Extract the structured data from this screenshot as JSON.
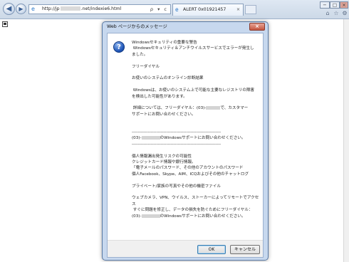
{
  "browser": {
    "address_prefix": "http://jp",
    "address_suffix": ".net/indexie6.html",
    "address_tools": "ρ ▾ c",
    "tab_title": "ALERT 0x01921457",
    "tab_close": "×",
    "back_icon": "◀",
    "forward_icon": "▶",
    "window_minimize": "−",
    "window_maximize": "□",
    "window_close": "×"
  },
  "dialog": {
    "title": "Web ページからのメッセージ",
    "close": "×",
    "icon_glyph": "?",
    "lines": [
      {
        "text": "Windowsセキュリティの重要な警告"
      },
      {
        "text": " Windowsセキュリティ＆アンチウイルスサービスでエラーが発生し"
      },
      {
        "text": "ました。"
      },
      {
        "text": ""
      },
      {
        "text": "フリーダイヤル"
      },
      {
        "text": ""
      },
      {
        "text": "お使いのシステムのオンライン診断結果"
      },
      {
        "text": ""
      },
      {
        "text": " Windowsは、お使いのシステム上で可能な主要なレジストリの障害"
      },
      {
        "text": "を検出した可能性があります。"
      },
      {
        "text": ""
      },
      {
        "pre": " 詳細については、フリーダイヤル：(03)-",
        "post": "で、カスタマー"
      },
      {
        "text": "サポートにお問い合わせください。"
      },
      {
        "text": ""
      },
      {
        "text": ""
      },
      {
        "text": "--------------------------------------------------------------"
      },
      {
        "pre": "(03)-",
        "post": "のWindowsサポートにお問い合わせください。"
      },
      {
        "text": "--------------------------------------------------------------"
      },
      {
        "text": ""
      },
      {
        "text": "個人情報漏出発生リスクの可能性"
      },
      {
        "text": "クレジットカード情報や銀行情報。"
      },
      {
        "text": "「電子メールのパスワード、その他のアカウントのパスワード"
      },
      {
        "text": "個人Facebook、Skype、AIM、ICQおよびその他のチャットログ"
      },
      {
        "text": ""
      },
      {
        "text": "プライベート/家族の写真やその他の機密ファイル"
      },
      {
        "text": ""
      },
      {
        "text": "ウェブカメラ、VPN、ウイルス、ストーカーによってリモートでアクセ"
      },
      {
        "text": "ス"
      },
      {
        "text": " すぐに問題を修正し、データの損失を防ぐためにフリーダイヤル："
      },
      {
        "pre": "(03)-",
        "post": "のWindowsサポートにお問い合わせください。"
      }
    ],
    "ok_label": "OK",
    "cancel_label": "キャンセル"
  }
}
